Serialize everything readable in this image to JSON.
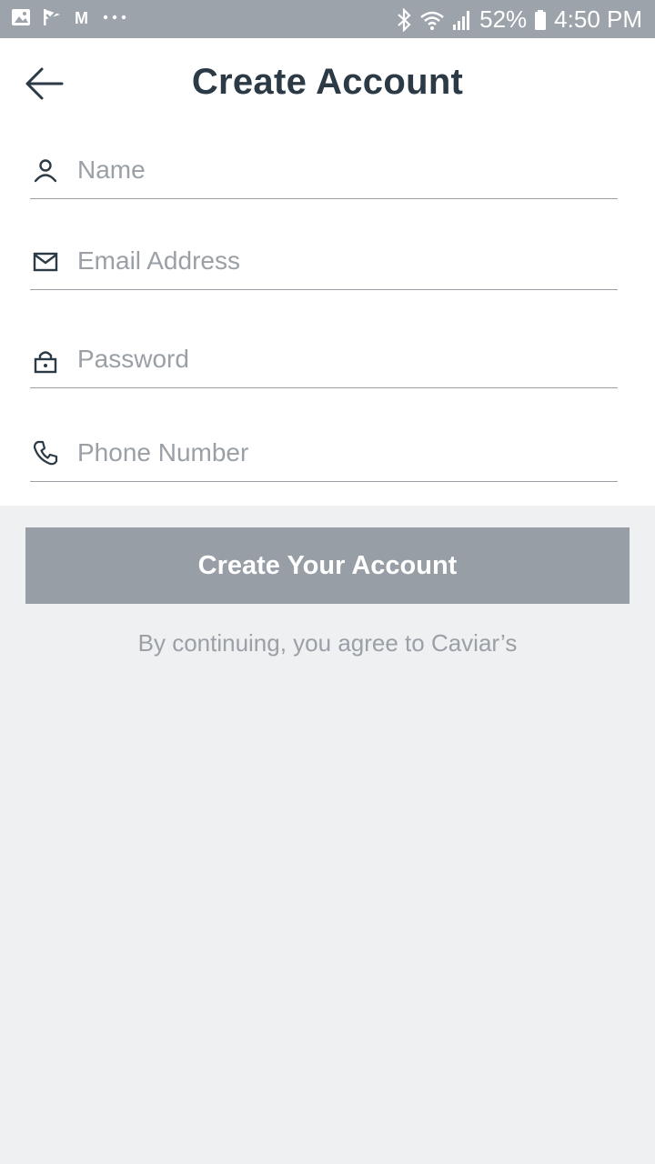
{
  "status_bar": {
    "battery": "52%",
    "time": "4:50 PM",
    "left_icons": [
      "gallery-icon",
      "check-flag-icon",
      "mail-icon",
      "more-dots-icon"
    ],
    "right_icons": [
      "bluetooth-icon",
      "wifi-icon",
      "signal-icon",
      "battery-icon"
    ]
  },
  "header": {
    "title": "Create Account",
    "back_icon": "arrow-left-icon"
  },
  "form": {
    "name": {
      "placeholder": "Name",
      "value": "",
      "icon": "person-icon"
    },
    "email": {
      "placeholder": "Email Address",
      "value": "",
      "icon": "envelope-icon"
    },
    "password": {
      "placeholder": "Password",
      "value": "",
      "icon": "lock-icon"
    },
    "phone": {
      "placeholder": "Phone Number",
      "value": "",
      "icon": "phone-icon"
    }
  },
  "submit_label": "Create Your Account",
  "legal_text": "By continuing, you agree to Caviar’s",
  "colors": {
    "status_bar": "#9ca3ab",
    "title": "#2c3a46",
    "button": "#979ea6",
    "background": "#eef0f2",
    "placeholder": "#9aa0a6"
  }
}
